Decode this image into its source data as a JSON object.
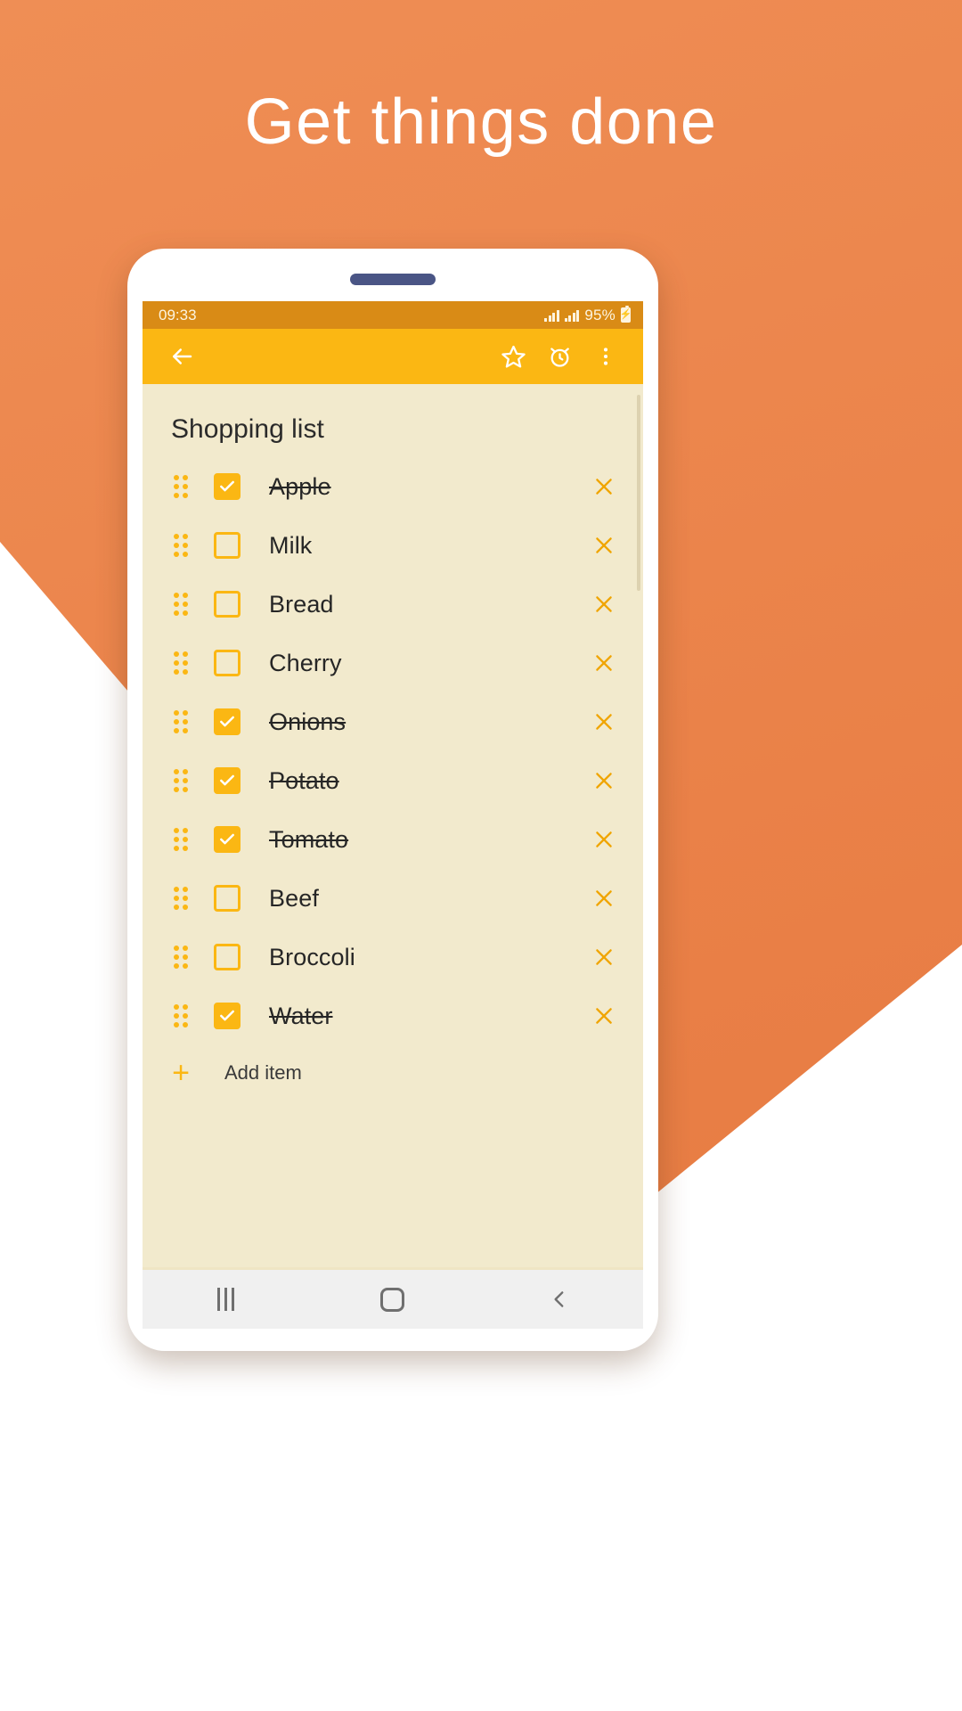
{
  "headline": "Get things done",
  "colors": {
    "background_orange": "#e97f46",
    "appbar": "#fbb713",
    "statusbar": "#d98b16",
    "note_paper": "#f2eacd",
    "toolbar": "#efe5c4",
    "accent": "#fbb713",
    "speaker": "#4a5585"
  },
  "statusbar": {
    "time": "09:33",
    "battery_percent": "95%",
    "signal_icon": "signal-bars-icon",
    "battery_icon": "battery-charging-icon"
  },
  "appbar": {
    "back_icon": "back-arrow-icon",
    "star_icon": "star-outline-icon",
    "alarm_icon": "alarm-clock-icon",
    "overflow_icon": "overflow-menu-icon"
  },
  "note": {
    "title": "Shopping list",
    "add_item_label": "Add item",
    "add_item_icon": "plus-icon",
    "items": [
      {
        "label": "Apple",
        "checked": true
      },
      {
        "label": "Milk",
        "checked": false
      },
      {
        "label": "Bread",
        "checked": false
      },
      {
        "label": "Cherry",
        "checked": false
      },
      {
        "label": "Onions",
        "checked": true
      },
      {
        "label": "Potato",
        "checked": true
      },
      {
        "label": "Tomato",
        "checked": true
      },
      {
        "label": "Beef",
        "checked": false
      },
      {
        "label": "Broccoli",
        "checked": false
      },
      {
        "label": "Water",
        "checked": true
      }
    ]
  },
  "toolbar": {
    "add_icon": "plus-icon",
    "undo_icon": "undo-icon",
    "redo_icon": "redo-icon",
    "save_icon": "save-floppy-icon"
  },
  "navbar": {
    "recents_icon": "recents-icon",
    "home_icon": "home-icon",
    "back_icon": "back-chevron-icon"
  }
}
